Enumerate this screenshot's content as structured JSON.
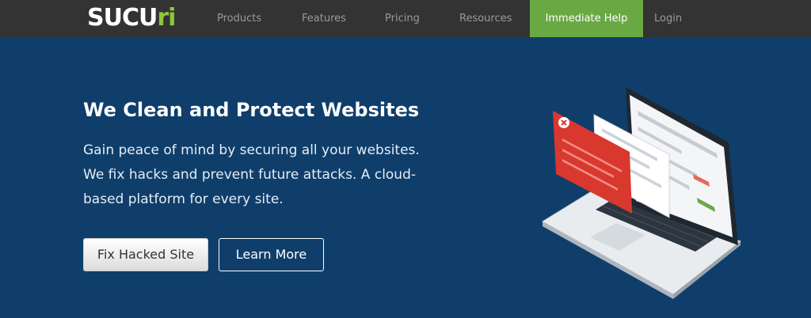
{
  "brand": {
    "logo_main": "SUCU",
    "logo_accent": "ri"
  },
  "nav": {
    "items": [
      "Products",
      "Features",
      "Pricing",
      "Resources"
    ],
    "help_label": "Immediate Help",
    "login_label": "Login"
  },
  "hero": {
    "title": "We Clean and Protect Websites",
    "description_lines": [
      "Gain peace of mind by securing all your websites.",
      "We fix hacks and prevent future attacks. A cloud-",
      "based platform for every site."
    ],
    "primary_button": "Fix Hacked Site",
    "secondary_button": "Learn More"
  },
  "colors": {
    "nav_bg": "#333333",
    "hero_bg": "#0f3e6b",
    "accent_green": "#6aa844",
    "alert_red": "#d9382f"
  },
  "illustration": {
    "icon": "laptop-with-security-alert"
  }
}
